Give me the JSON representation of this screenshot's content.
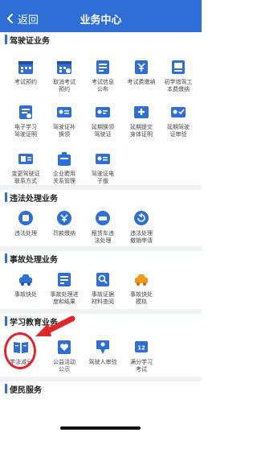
{
  "header": {
    "back_label": "返回",
    "title": "业务中心"
  },
  "colors": {
    "accent": "#2F6ED6",
    "annotation": "#E0252B"
  },
  "sections": [
    {
      "title": "驾驶证业务",
      "items": [
        {
          "label": "考试预约",
          "icon": "calendar-icon"
        },
        {
          "label": "取消考试\n预约",
          "icon": "calendar-cancel-icon"
        },
        {
          "label": "考试信息\n公布",
          "icon": "notice-icon"
        },
        {
          "label": "考试费缴纳",
          "icon": "payment-icon"
        },
        {
          "label": "初学增驾工\n本费缴纳",
          "icon": "book-payment-icon"
        },
        {
          "label": "电子学习\n驾驶证明",
          "icon": "study-certificate-icon"
        },
        {
          "label": "驾驶证补\n换领",
          "icon": "license-renew-icon"
        },
        {
          "label": "延期换领\n驾驶证",
          "icon": "license-postpone-icon"
        },
        {
          "label": "延期提交\n身体证明",
          "icon": "health-certificate-icon"
        },
        {
          "label": "延期驾驶\n证审验",
          "icon": "license-review-icon"
        },
        {
          "label": "变更驾驶证\n联系方式",
          "icon": "contact-change-icon"
        },
        {
          "label": "企业聘用\n关系管理",
          "icon": "enterprise-icon"
        },
        {
          "label": "驾驶证电\n子版",
          "icon": "e-license-icon"
        }
      ]
    },
    {
      "title": "违法处理业务",
      "items": [
        {
          "label": "违法处理",
          "icon": "violation-icon"
        },
        {
          "label": "罚款缴纳",
          "icon": "fine-icon"
        },
        {
          "label": "租赁车违\n法处理",
          "icon": "rental-violation-icon"
        },
        {
          "label": "违法处理\n撤销申请",
          "icon": "revoke-icon"
        }
      ]
    },
    {
      "title": "事故处理业务",
      "items": [
        {
          "label": "事故快处",
          "icon": "accident-icon"
        },
        {
          "label": "事故处理进\n度和结果",
          "icon": "progress-icon"
        },
        {
          "label": "事故证据\n材料查阅",
          "icon": "evidence-icon"
        },
        {
          "label": "事故快处\n模拟",
          "icon": "simulate-icon"
        }
      ]
    },
    {
      "title": "学习教育业务",
      "items": [
        {
          "label": "学法减分",
          "icon": "open-book-icon"
        },
        {
          "label": "公益活动\n公示",
          "icon": "heart-icon"
        },
        {
          "label": "驾驶人审验",
          "icon": "reviewer-icon"
        },
        {
          "label": "满分学习\n考试",
          "icon": "score-12-icon"
        }
      ]
    },
    {
      "title": "便民服务",
      "items": []
    }
  ]
}
